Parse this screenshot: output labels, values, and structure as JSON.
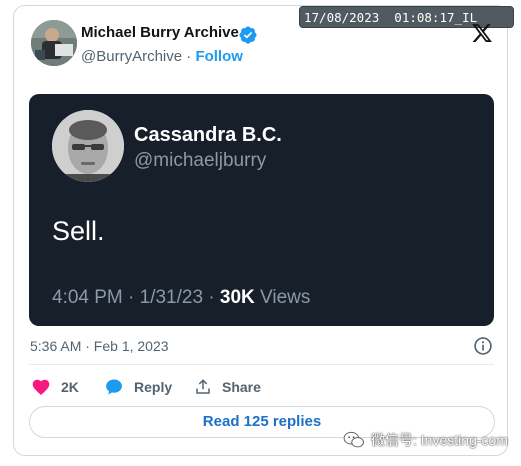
{
  "header": {
    "author_name": "Michael Burry Archive",
    "handle": "@BurryArchive",
    "separator": " · ",
    "follow_label": "Follow"
  },
  "overlay": {
    "timestamp": "17/08/2023  01:08:17_IL"
  },
  "quoted_post": {
    "name": "Cassandra B.C.",
    "handle": "@michaeljburry",
    "text": "Sell.",
    "time": "4:04 PM · 1/31/23 · ",
    "views_count": "30K",
    "views_label": " Views"
  },
  "post": {
    "timestamp": "5:36 AM · Feb 1, 2023"
  },
  "actions": {
    "like_count": "2K",
    "reply_label": "Reply",
    "share_label": "Share"
  },
  "read_replies_label": "Read 125 replies",
  "watermark_text": "微信号: Investing-com",
  "colors": {
    "accent": "#1d9bf0",
    "like": "#f91880",
    "quote_bg": "#17202a"
  },
  "icons": [
    "verified-badge-icon",
    "x-logo-icon",
    "info-icon",
    "heart-icon",
    "reply-bubble-icon",
    "share-icon",
    "wechat-icon"
  ]
}
